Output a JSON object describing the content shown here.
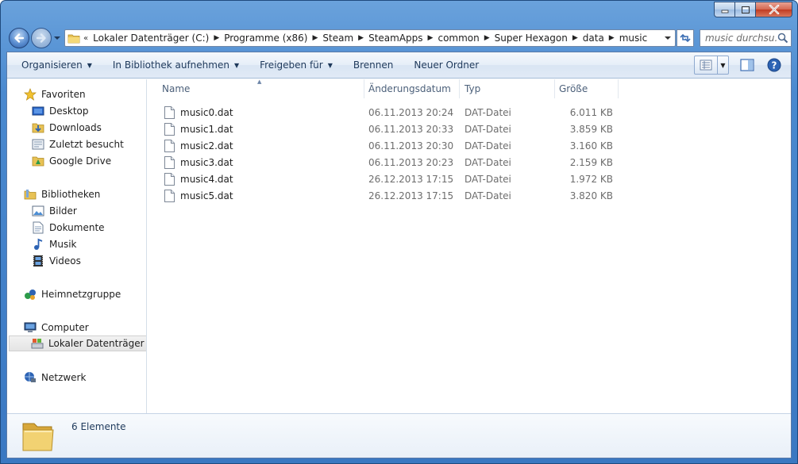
{
  "address": {
    "overflow": "«",
    "crumbs": [
      "Lokaler Datenträger (C:)",
      "Programme (x86)",
      "Steam",
      "SteamApps",
      "common",
      "Super Hexagon",
      "data",
      "music"
    ]
  },
  "search": {
    "placeholder": "music durchsu..."
  },
  "toolbar": {
    "organize": "Organisieren",
    "library": "In Bibliothek aufnehmen",
    "share": "Freigeben für",
    "burn": "Brennen",
    "new_folder": "Neuer Ordner"
  },
  "nav": {
    "favorites": "Favoriten",
    "desktop": "Desktop",
    "downloads": "Downloads",
    "recent": "Zuletzt besucht",
    "gdrive": "Google Drive",
    "libraries": "Bibliotheken",
    "pictures": "Bilder",
    "documents": "Dokumente",
    "music": "Musik",
    "videos": "Videos",
    "homegroup": "Heimnetzgruppe",
    "computer": "Computer",
    "localdisk": "Lokaler Datenträger (C:)",
    "network": "Netzwerk"
  },
  "columns": {
    "name": "Name",
    "date": "Änderungsdatum",
    "type": "Typ",
    "size": "Größe"
  },
  "files": [
    {
      "name": "music0.dat",
      "date": "06.11.2013 20:24",
      "type": "DAT-Datei",
      "size": "6.011 KB"
    },
    {
      "name": "music1.dat",
      "date": "06.11.2013 20:33",
      "type": "DAT-Datei",
      "size": "3.859 KB"
    },
    {
      "name": "music2.dat",
      "date": "06.11.2013 20:30",
      "type": "DAT-Datei",
      "size": "3.160 KB"
    },
    {
      "name": "music3.dat",
      "date": "06.11.2013 20:23",
      "type": "DAT-Datei",
      "size": "2.159 KB"
    },
    {
      "name": "music4.dat",
      "date": "26.12.2013 17:15",
      "type": "DAT-Datei",
      "size": "1.972 KB"
    },
    {
      "name": "music5.dat",
      "date": "26.12.2013 17:15",
      "type": "DAT-Datei",
      "size": "3.820 KB"
    }
  ],
  "details": {
    "count": "6 Elemente"
  },
  "icons": {
    "caption": [
      "minimize-icon",
      "maximize-icon",
      "close-icon"
    ],
    "nav": [
      "back-arrow-icon",
      "forward-arrow-icon",
      "refresh-icon",
      "search-icon"
    ]
  }
}
